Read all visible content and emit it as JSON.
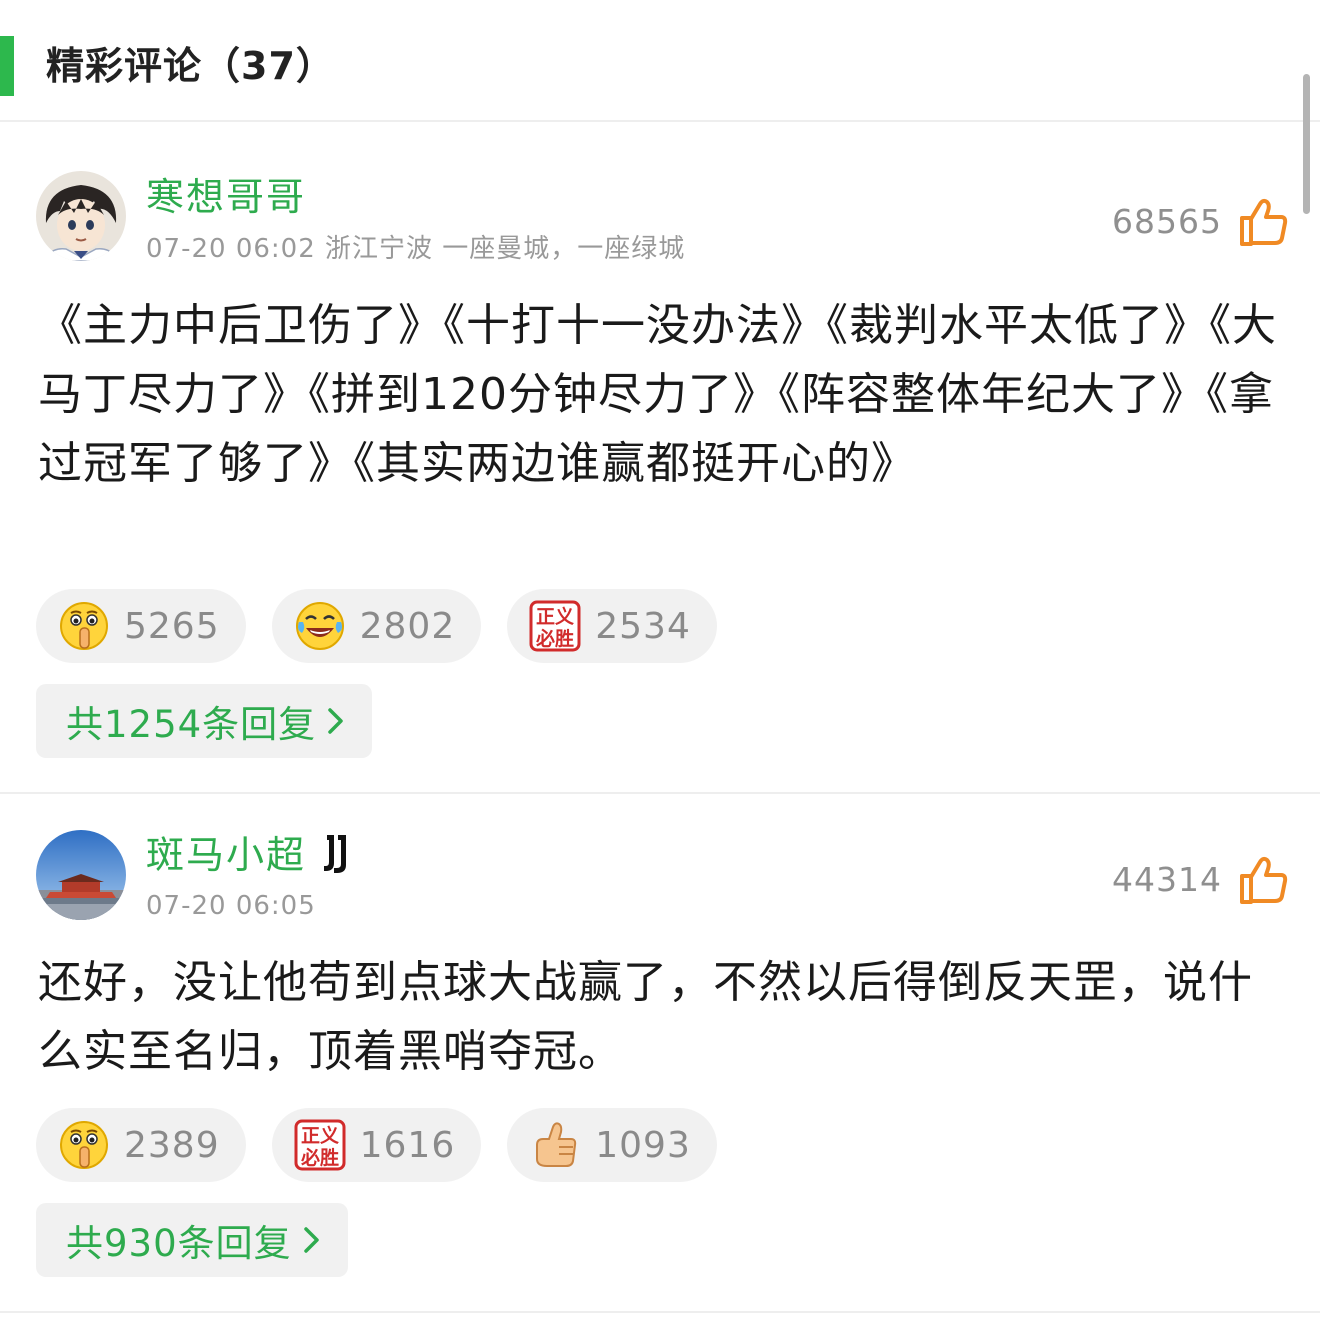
{
  "header": {
    "title": "精彩评论（37）"
  },
  "comments": [
    {
      "username": "寒想哥哥",
      "meta": "07-20 06:02 浙江宁波 一座曼城，一座绿城",
      "likes": "68565",
      "text": "《主力中后卫伤了》《十打十一没办法》《裁判水平太低了》《大马丁尽力了》《拼到120分钟尽力了》《阵容整体年纪大了》《拿过冠军了够了》《其实两边谁赢都挺开心的》",
      "reactions": [
        {
          "icon": "shush-emoji-icon",
          "count": "5265"
        },
        {
          "icon": "laughing-tears-emoji-icon",
          "count": "2802"
        },
        {
          "icon": "justice-prevails-sticker-icon",
          "count": "2534",
          "sticker_text": "正义必胜"
        }
      ],
      "replies": "共1254条回复"
    },
    {
      "username": "斑马小超",
      "badge": "juventus-logo-icon",
      "meta": "07-20 06:05",
      "likes": "44314",
      "text": "还好，没让他苟到点球大战赢了，不然以后得倒反天罡，说什么实至名归，顶着黑哨夺冠。",
      "reactions": [
        {
          "icon": "shush-emoji-icon",
          "count": "2389"
        },
        {
          "icon": "justice-prevails-sticker-icon",
          "count": "1616",
          "sticker_text": "正义必胜"
        },
        {
          "icon": "thumbs-up-emoji-icon",
          "count": "1093"
        }
      ],
      "replies": "共930条回复"
    }
  ],
  "colors": {
    "accent": "#2db84d",
    "username": "#2eab4e",
    "meta": "#999999",
    "like_icon": "#f08a24",
    "pill_bg": "#f1f1f1"
  }
}
